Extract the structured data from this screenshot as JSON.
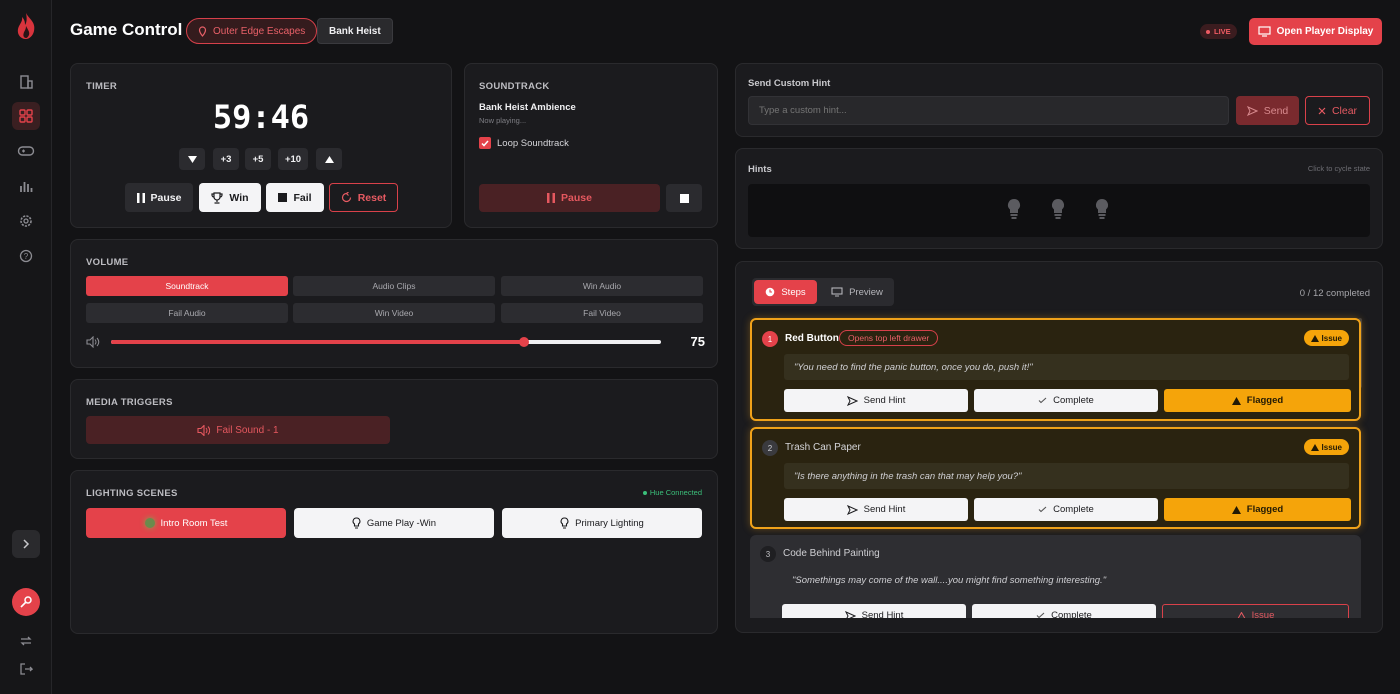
{
  "header": {
    "title": "Game Control",
    "location": "Outer Edge Escapes",
    "room": "Bank Heist",
    "live": "LIVE",
    "open_display": "Open Player Display"
  },
  "timer": {
    "label": "TIMER",
    "time": "59:46",
    "add3": "+3",
    "add5": "+5",
    "add10": "+10",
    "pause": "Pause",
    "win": "Win",
    "fail": "Fail",
    "reset": "Reset"
  },
  "soundtrack": {
    "label": "SOUNDTRACK",
    "track": "Bank Heist Ambience",
    "status": "Now playing...",
    "loop": "Loop Soundtrack",
    "loop_checked": true,
    "pause": "Pause"
  },
  "volume": {
    "label": "VOLUME",
    "tabs": [
      "Soundtrack",
      "Audio Clips",
      "Win Audio",
      "Fail Audio",
      "Win Video",
      "Fail Video"
    ],
    "active": "Soundtrack",
    "value": "75",
    "level": 0.75
  },
  "media": {
    "label": "MEDIA TRIGGERS",
    "item": "Fail Sound - 1"
  },
  "lighting": {
    "label": "LIGHTING SCENES",
    "status": "Hue Connected",
    "scenes": [
      "Intro Room Test",
      "Game Play -Win",
      "Primary Lighting"
    ]
  },
  "hint": {
    "label": "Send Custom Hint",
    "placeholder": "Type a custom hint...",
    "send": "Send",
    "clear": "Clear"
  },
  "hints": {
    "label": "Hints",
    "note": "Click to cycle state"
  },
  "steps": {
    "tab_steps": "Steps",
    "tab_preview": "Preview",
    "progress": "0 / 12 completed",
    "send": "Send Hint",
    "complete": "Complete",
    "flagged": "Flagged",
    "issue": "Issue",
    "items": [
      {
        "num": "1",
        "title": "Red Button",
        "tag": "Opens top left drawer",
        "quote": "\"You need to find the panic button, once you do, push it!\""
      },
      {
        "num": "2",
        "title": "Trash Can Paper",
        "quote": "\"Is there anything in the trash can that may help you?\""
      },
      {
        "num": "3",
        "title": "Code Behind Painting",
        "quote": "\"Somethings may come of the wall....you might find something interesting.\""
      }
    ]
  },
  "colors": {
    "accent": "#e4424a",
    "flag": "#f5a40a",
    "bg": "#131315",
    "card": "#1b1b1e"
  }
}
